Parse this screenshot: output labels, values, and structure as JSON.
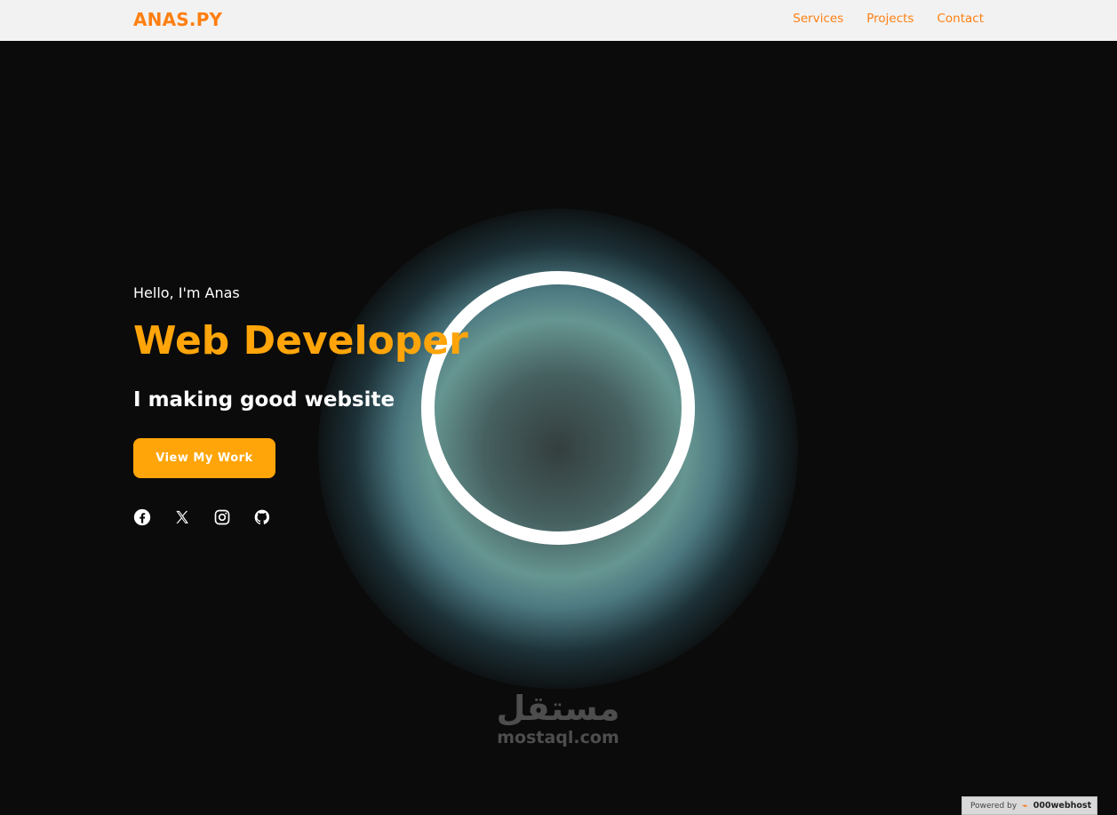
{
  "navbar": {
    "brand": "ANAS.PY",
    "links": [
      "Services",
      "Projects",
      "Contact"
    ]
  },
  "hero": {
    "greeting": "Hello, I'm Anas",
    "title": "Web Developer",
    "tagline": "I making good website",
    "cta_label": "View My Work",
    "socials": [
      "facebook-icon",
      "x-icon",
      "instagram-icon",
      "github-icon"
    ]
  },
  "watermark": {
    "arabic": "مستقل",
    "latin": "mostaql.com"
  },
  "hosting_badge": {
    "prefix": "Powered by",
    "host": "000webhost"
  },
  "colors": {
    "accent": "#ffa50a",
    "brand_orange": "#ff7f11",
    "background": "#0b0b0b",
    "navbar": "#f2f2f2"
  }
}
